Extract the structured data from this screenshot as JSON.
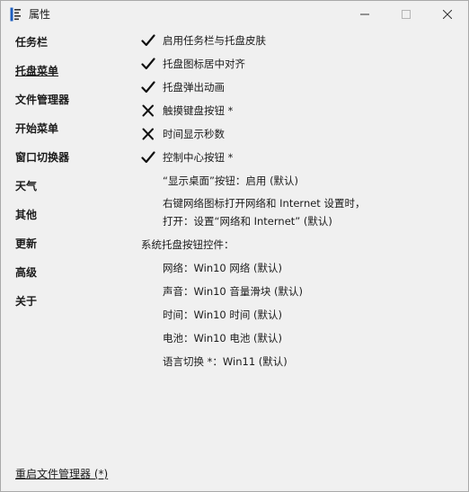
{
  "window": {
    "title": "属性",
    "icons": {
      "app": "explorer-app-icon",
      "minimize": "minimize-icon",
      "maximize": "maximize-icon",
      "close": "close-icon"
    }
  },
  "sidebar": {
    "items": [
      {
        "label": "任务栏"
      },
      {
        "label": "托盘菜单",
        "selected": true
      },
      {
        "label": "文件管理器"
      },
      {
        "label": "开始菜单"
      },
      {
        "label": "窗口切换器"
      },
      {
        "label": "天气"
      },
      {
        "label": "其他"
      },
      {
        "label": "更新"
      },
      {
        "label": "高级"
      },
      {
        "label": "关于"
      }
    ]
  },
  "content": {
    "options": [
      {
        "label": "启用任务栏与托盘皮肤",
        "state": "check"
      },
      {
        "label": "托盘图标居中对齐",
        "state": "check"
      },
      {
        "label": "托盘弹出动画",
        "state": "check"
      },
      {
        "label": "触摸键盘按钮 *",
        "state": "cross"
      },
      {
        "label": "时间显示秒数",
        "state": "cross"
      },
      {
        "label": "控制中心按钮 *",
        "state": "check"
      }
    ],
    "show_desktop": "“显示桌面”按钮：启用 (默认)",
    "network_right_click_line1": "右键网络图标打开网络和 Internet 设置时，",
    "network_right_click_line2": "打开：设置“网络和 Internet” (默认)",
    "tray_controls_heading": "系统托盘按钮控件：",
    "tray_controls": [
      "网络：Win10 网络 (默认)",
      "声音：Win10 音量滑块 (默认)",
      "时间：Win10 时间 (默认)",
      "电池：Win10 电池 (默认)",
      "语言切换 *：Win11 (默认)"
    ]
  },
  "footer": {
    "restart_link": "重启文件管理器 (*)"
  }
}
